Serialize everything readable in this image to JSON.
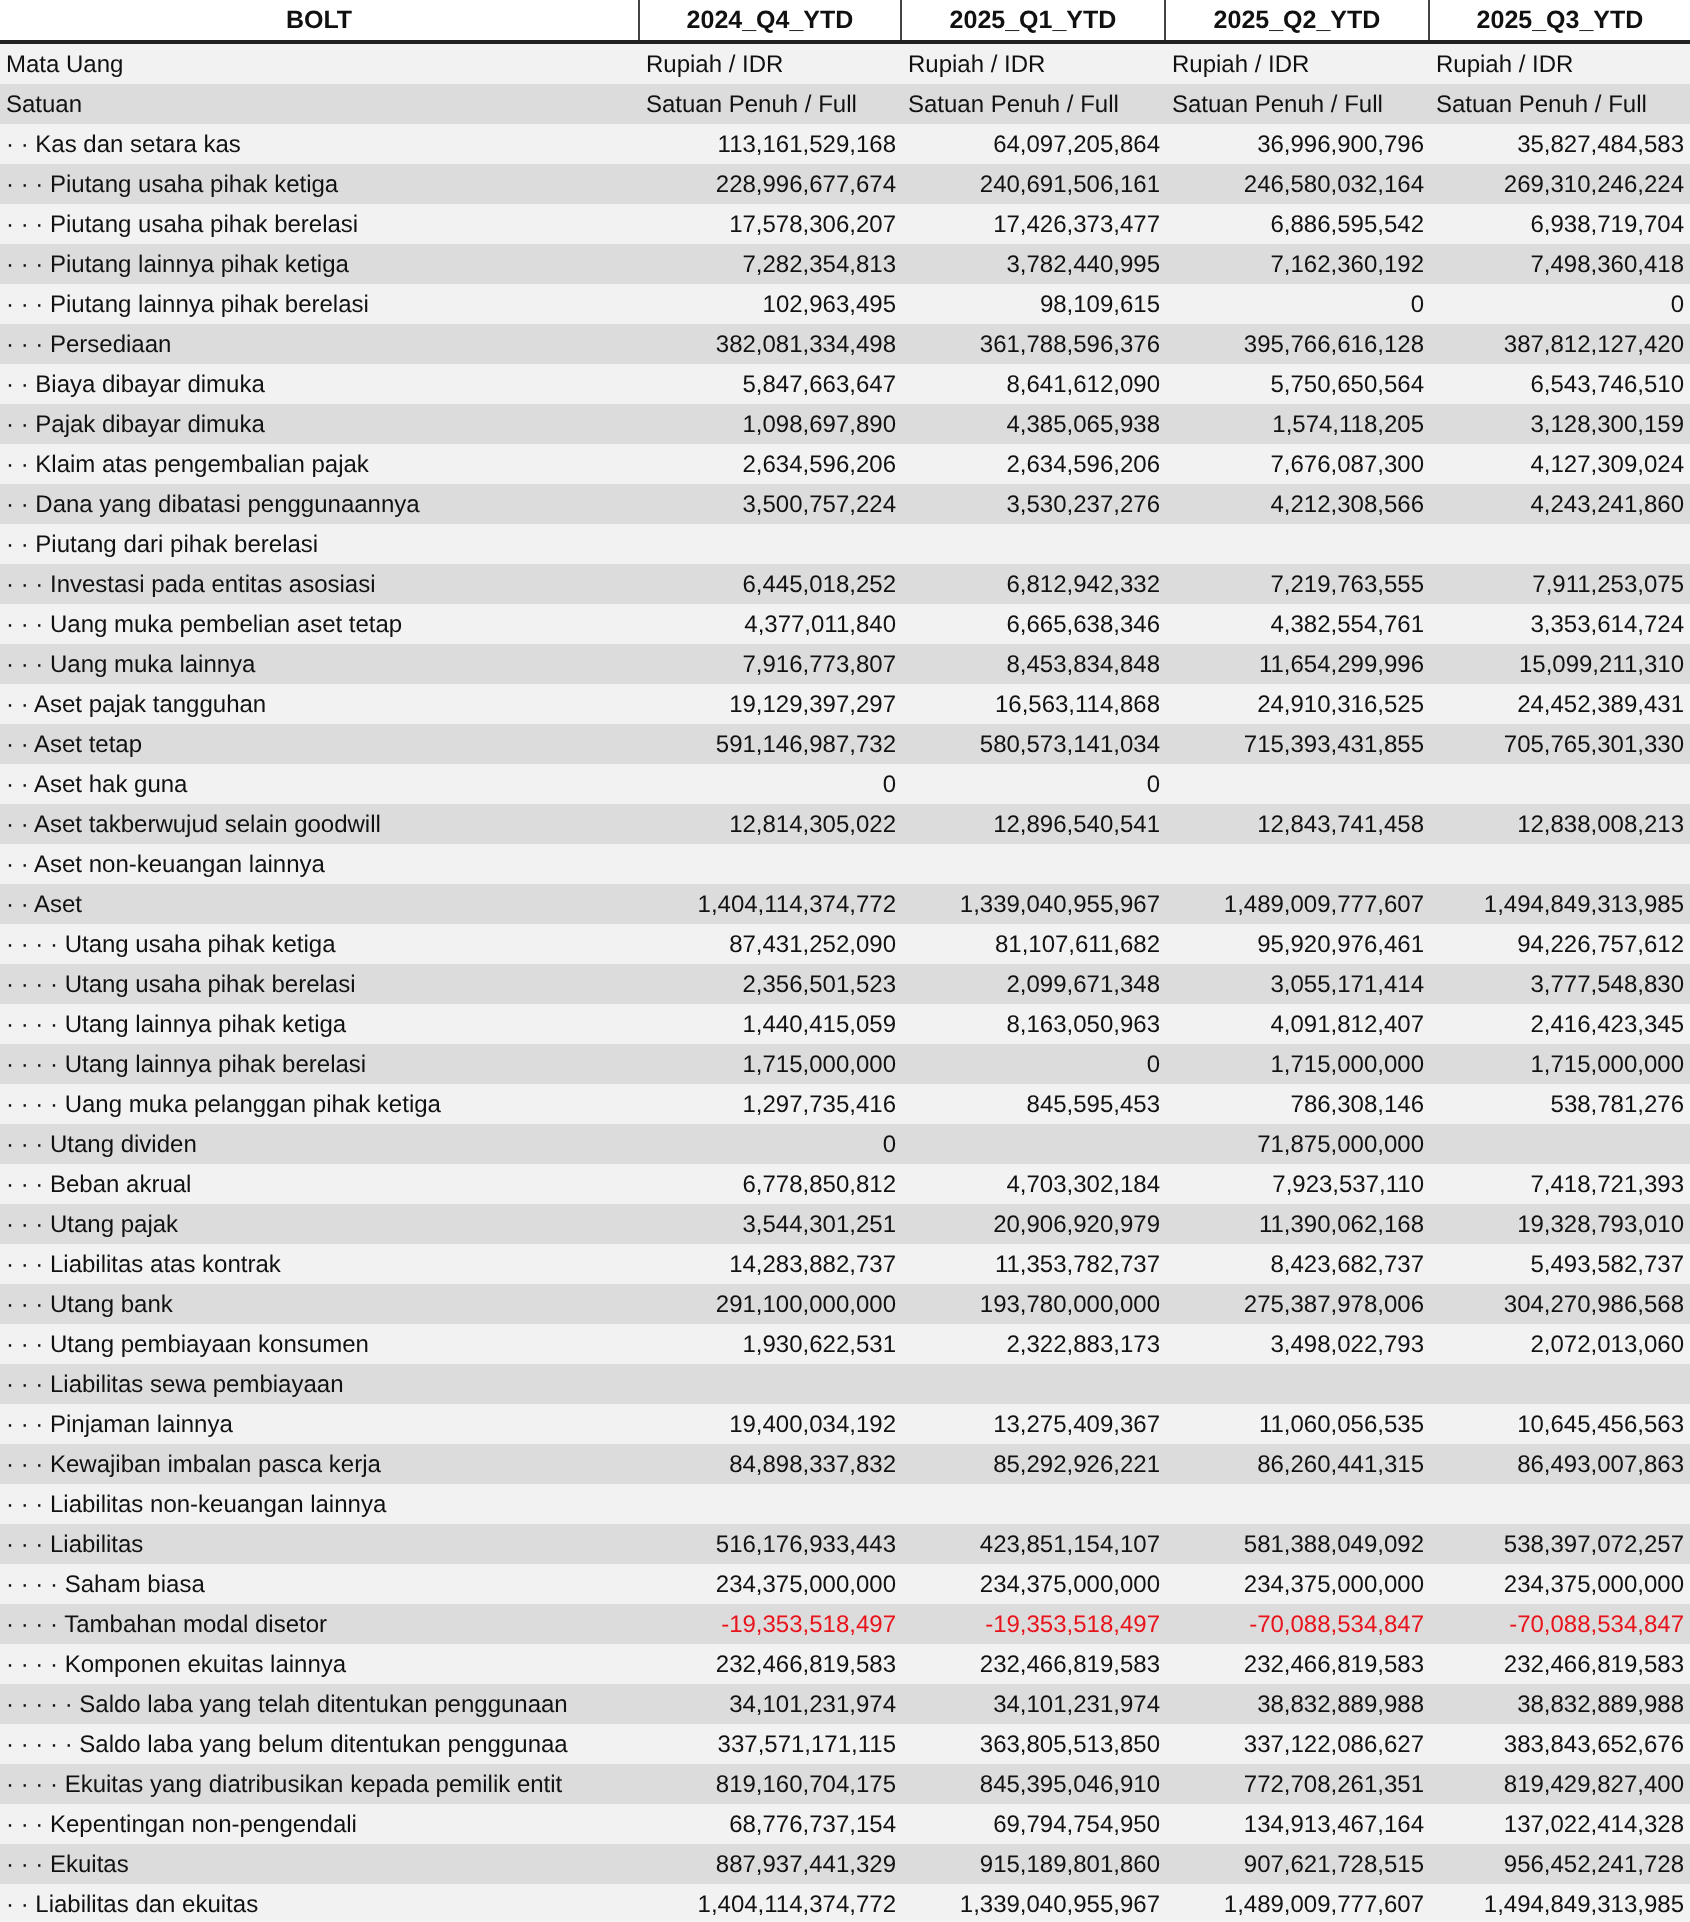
{
  "table": {
    "columns": [
      "BOLT",
      "2024_Q4_YTD",
      "2025_Q1_YTD",
      "2025_Q2_YTD",
      "2025_Q3_YTD"
    ],
    "meta_rows": [
      {
        "label": "Mata Uang",
        "q4_2024": "Rupiah / IDR",
        "q1_2025": "Rupiah / IDR",
        "q2_2025": "Rupiah / IDR",
        "q3_2025": "Rupiah / IDR"
      },
      {
        "label": "Satuan",
        "q4_2024": "Satuan Penuh / Full",
        "q1_2025": "Satuan Penuh / Full",
        "q2_2025": "Satuan Penuh / Full",
        "q3_2025": "Satuan Penuh / Full"
      }
    ],
    "rows": [
      {
        "label": "· · Kas dan setara kas",
        "negative": false,
        "q4_2024": "113,161,529,168",
        "q1_2025": "64,097,205,864",
        "q2_2025": "36,996,900,796",
        "q3_2025": "35,827,484,583"
      },
      {
        "label": "· · · Piutang usaha pihak ketiga",
        "negative": false,
        "q4_2024": "228,996,677,674",
        "q1_2025": "240,691,506,161",
        "q2_2025": "246,580,032,164",
        "q3_2025": "269,310,246,224"
      },
      {
        "label": "· · · Piutang usaha pihak berelasi",
        "negative": false,
        "q4_2024": "17,578,306,207",
        "q1_2025": "17,426,373,477",
        "q2_2025": "6,886,595,542",
        "q3_2025": "6,938,719,704"
      },
      {
        "label": "· · · Piutang lainnya pihak ketiga",
        "negative": false,
        "q4_2024": "7,282,354,813",
        "q1_2025": "3,782,440,995",
        "q2_2025": "7,162,360,192",
        "q3_2025": "7,498,360,418"
      },
      {
        "label": "· · · Piutang lainnya pihak berelasi",
        "negative": false,
        "q4_2024": "102,963,495",
        "q1_2025": "98,109,615",
        "q2_2025": "0",
        "q3_2025": "0"
      },
      {
        "label": "· · · Persediaan",
        "negative": false,
        "q4_2024": "382,081,334,498",
        "q1_2025": "361,788,596,376",
        "q2_2025": "395,766,616,128",
        "q3_2025": "387,812,127,420"
      },
      {
        "label": "· · Biaya dibayar dimuka",
        "negative": false,
        "q4_2024": "5,847,663,647",
        "q1_2025": "8,641,612,090",
        "q2_2025": "5,750,650,564",
        "q3_2025": "6,543,746,510"
      },
      {
        "label": "· · Pajak dibayar dimuka",
        "negative": false,
        "q4_2024": "1,098,697,890",
        "q1_2025": "4,385,065,938",
        "q2_2025": "1,574,118,205",
        "q3_2025": "3,128,300,159"
      },
      {
        "label": "· · Klaim atas pengembalian pajak",
        "negative": false,
        "q4_2024": "2,634,596,206",
        "q1_2025": "2,634,596,206",
        "q2_2025": "7,676,087,300",
        "q3_2025": "4,127,309,024"
      },
      {
        "label": "· · Dana yang dibatasi penggunaannya",
        "negative": false,
        "q4_2024": "3,500,757,224",
        "q1_2025": "3,530,237,276",
        "q2_2025": "4,212,308,566",
        "q3_2025": "4,243,241,860"
      },
      {
        "label": "· · Piutang dari pihak berelasi"
      },
      {
        "label": "· · · Investasi pada entitas asosiasi",
        "negative": false,
        "q4_2024": "6,445,018,252",
        "q1_2025": "6,812,942,332",
        "q2_2025": "7,219,763,555",
        "q3_2025": "7,911,253,075"
      },
      {
        "label": "· · · Uang muka pembelian aset tetap",
        "negative": false,
        "q4_2024": "4,377,011,840",
        "q1_2025": "6,665,638,346",
        "q2_2025": "4,382,554,761",
        "q3_2025": "3,353,614,724"
      },
      {
        "label": "· · · Uang muka lainnya",
        "negative": false,
        "q4_2024": "7,916,773,807",
        "q1_2025": "8,453,834,848",
        "q2_2025": "11,654,299,996",
        "q3_2025": "15,099,211,310"
      },
      {
        "label": "· · Aset pajak tangguhan",
        "negative": false,
        "q4_2024": "19,129,397,297",
        "q1_2025": "16,563,114,868",
        "q2_2025": "24,910,316,525",
        "q3_2025": "24,452,389,431"
      },
      {
        "label": "· · Aset tetap",
        "negative": false,
        "q4_2024": "591,146,987,732",
        "q1_2025": "580,573,141,034",
        "q2_2025": "715,393,431,855",
        "q3_2025": "705,765,301,330"
      },
      {
        "label": "· · Aset hak guna",
        "negative": false,
        "q4_2024": "0",
        "q1_2025": "0"
      },
      {
        "label": "· · Aset takberwujud selain goodwill",
        "negative": false,
        "q4_2024": "12,814,305,022",
        "q1_2025": "12,896,540,541",
        "q2_2025": "12,843,741,458",
        "q3_2025": "12,838,008,213"
      },
      {
        "label": "· · Aset non-keuangan lainnya"
      },
      {
        "label": "· · Aset",
        "negative": false,
        "q4_2024": "1,404,114,374,772",
        "q1_2025": "1,339,040,955,967",
        "q2_2025": "1,489,009,777,607",
        "q3_2025": "1,494,849,313,985"
      },
      {
        "label": "· · · · Utang usaha pihak ketiga",
        "negative": false,
        "q4_2024": "87,431,252,090",
        "q1_2025": "81,107,611,682",
        "q2_2025": "95,920,976,461",
        "q3_2025": "94,226,757,612"
      },
      {
        "label": "· · · · Utang usaha pihak berelasi",
        "negative": false,
        "q4_2024": "2,356,501,523",
        "q1_2025": "2,099,671,348",
        "q2_2025": "3,055,171,414",
        "q3_2025": "3,777,548,830"
      },
      {
        "label": "· · · · Utang lainnya pihak ketiga",
        "negative": false,
        "q4_2024": "1,440,415,059",
        "q1_2025": "8,163,050,963",
        "q2_2025": "4,091,812,407",
        "q3_2025": "2,416,423,345"
      },
      {
        "label": "· · · · Utang lainnya pihak berelasi",
        "negative": false,
        "q4_2024": "1,715,000,000",
        "q1_2025": "0",
        "q2_2025": "1,715,000,000",
        "q3_2025": "1,715,000,000"
      },
      {
        "label": "· · · · Uang muka pelanggan pihak ketiga",
        "negative": false,
        "q4_2024": "1,297,735,416",
        "q1_2025": "845,595,453",
        "q2_2025": "786,308,146",
        "q3_2025": "538,781,276"
      },
      {
        "label": "· · · Utang dividen",
        "negative": false,
        "q4_2024": "0",
        "q2_2025": "71,875,000,000"
      },
      {
        "label": "· · · Beban akrual",
        "negative": false,
        "q4_2024": "6,778,850,812",
        "q1_2025": "4,703,302,184",
        "q2_2025": "7,923,537,110",
        "q3_2025": "7,418,721,393"
      },
      {
        "label": "· · · Utang pajak",
        "negative": false,
        "q4_2024": "3,544,301,251",
        "q1_2025": "20,906,920,979",
        "q2_2025": "11,390,062,168",
        "q3_2025": "19,328,793,010"
      },
      {
        "label": "· · · Liabilitas atas kontrak",
        "negative": false,
        "q4_2024": "14,283,882,737",
        "q1_2025": "11,353,782,737",
        "q2_2025": "8,423,682,737",
        "q3_2025": "5,493,582,737"
      },
      {
        "label": "· · · Utang bank",
        "negative": false,
        "q4_2024": "291,100,000,000",
        "q1_2025": "193,780,000,000",
        "q2_2025": "275,387,978,006",
        "q3_2025": "304,270,986,568"
      },
      {
        "label": "· · · Utang pembiayaan konsumen",
        "negative": false,
        "q4_2024": "1,930,622,531",
        "q1_2025": "2,322,883,173",
        "q2_2025": "3,498,022,793",
        "q3_2025": "2,072,013,060"
      },
      {
        "label": "· · · Liabilitas sewa pembiayaan"
      },
      {
        "label": "· · · Pinjaman lainnya",
        "negative": false,
        "q4_2024": "19,400,034,192",
        "q1_2025": "13,275,409,367",
        "q2_2025": "11,060,056,535",
        "q3_2025": "10,645,456,563"
      },
      {
        "label": "· · · Kewajiban imbalan pasca kerja",
        "negative": false,
        "q4_2024": "84,898,337,832",
        "q1_2025": "85,292,926,221",
        "q2_2025": "86,260,441,315",
        "q3_2025": "86,493,007,863"
      },
      {
        "label": "· · · Liabilitas non-keuangan lainnya"
      },
      {
        "label": "· · · Liabilitas",
        "negative": false,
        "q4_2024": "516,176,933,443",
        "q1_2025": "423,851,154,107",
        "q2_2025": "581,388,049,092",
        "q3_2025": "538,397,072,257"
      },
      {
        "label": "· · · · Saham biasa",
        "negative": false,
        "q4_2024": "234,375,000,000",
        "q1_2025": "234,375,000,000",
        "q2_2025": "234,375,000,000",
        "q3_2025": "234,375,000,000"
      },
      {
        "label": "· · · · Tambahan modal disetor",
        "negative": true,
        "q4_2024": "-19,353,518,497",
        "q1_2025": "-19,353,518,497",
        "q2_2025": "-70,088,534,847",
        "q3_2025": "-70,088,534,847"
      },
      {
        "label": "· · · · Komponen ekuitas lainnya",
        "negative": false,
        "q4_2024": "232,466,819,583",
        "q1_2025": "232,466,819,583",
        "q2_2025": "232,466,819,583",
        "q3_2025": "232,466,819,583"
      },
      {
        "label": "· · · · · Saldo laba yang telah ditentukan penggunaan",
        "negative": false,
        "q4_2024": "34,101,231,974",
        "q1_2025": "34,101,231,974",
        "q2_2025": "38,832,889,988",
        "q3_2025": "38,832,889,988"
      },
      {
        "label": "· · · · · Saldo laba yang belum ditentukan penggunaa",
        "negative": false,
        "q4_2024": "337,571,171,115",
        "q1_2025": "363,805,513,850",
        "q2_2025": "337,122,086,627",
        "q3_2025": "383,843,652,676"
      },
      {
        "label": "· · · · Ekuitas yang diatribusikan kepada pemilik entit",
        "negative": false,
        "q4_2024": "819,160,704,175",
        "q1_2025": "845,395,046,910",
        "q2_2025": "772,708,261,351",
        "q3_2025": "819,429,827,400"
      },
      {
        "label": "· · · Kepentingan non-pengendali",
        "negative": false,
        "q4_2024": "68,776,737,154",
        "q1_2025": "69,794,754,950",
        "q2_2025": "134,913,467,164",
        "q3_2025": "137,022,414,328"
      },
      {
        "label": "· · · Ekuitas",
        "negative": false,
        "q4_2024": "887,937,441,329",
        "q1_2025": "915,189,801,860",
        "q2_2025": "907,621,728,515",
        "q3_2025": "956,452,241,728"
      },
      {
        "label": "· · Liabilitas dan ekuitas",
        "negative": false,
        "q4_2024": "1,404,114,374,772",
        "q1_2025": "1,339,040,955,967",
        "q2_2025": "1,489,009,777,607",
        "q3_2025": "1,494,849,313,985"
      }
    ]
  }
}
